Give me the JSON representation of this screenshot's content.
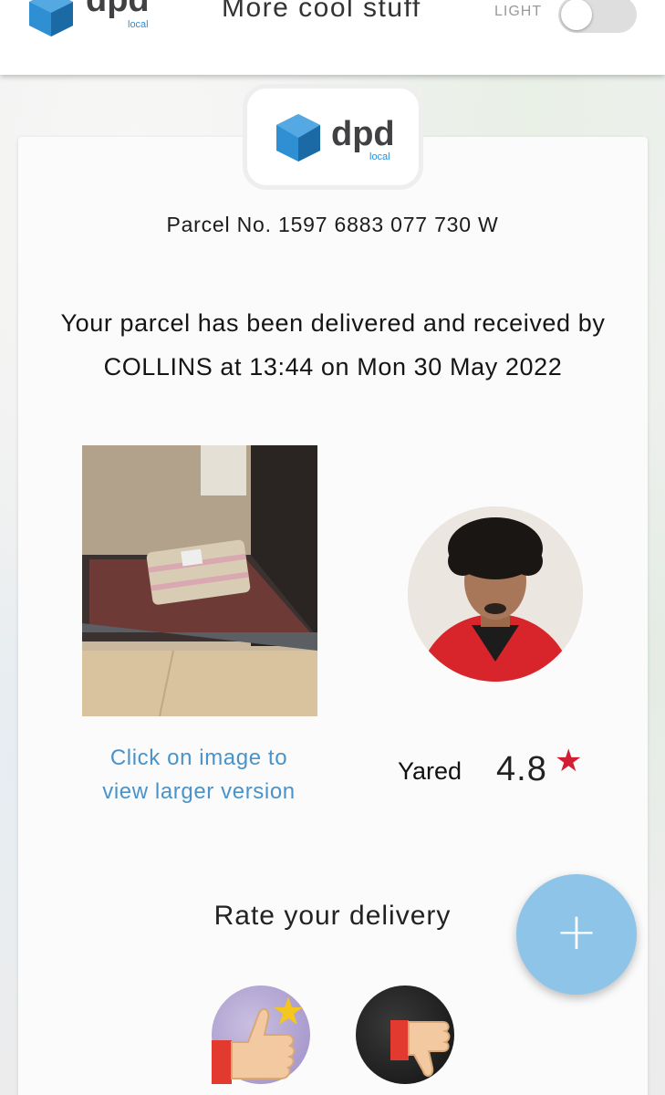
{
  "header": {
    "title": "More cool stuff",
    "theme_label": "LIGHT",
    "theme_on": false
  },
  "brand": {
    "name": "dpd",
    "sub": "local",
    "colors": {
      "cube": "#2f8fd3",
      "cube_dark": "#1b6aa6",
      "text": "#414042"
    }
  },
  "parcel": {
    "number_text": "Parcel No. 1597 6883 077 730 W",
    "status_line1": "Your parcel has been delivered and received by",
    "status_line2": "COLLINS at 13:44 on Mon 30 May 2022"
  },
  "photo": {
    "hint_line1": "Click on image to",
    "hint_line2": "view larger version"
  },
  "driver": {
    "name": "Yared",
    "rating": "4.8",
    "star_color": "#d11e34"
  },
  "rating": {
    "title": "Rate your delivery",
    "good_icon": "thumbs-up-icon",
    "bad_icon": "thumbs-down-icon"
  },
  "fab": {
    "icon": "plus-icon",
    "color": "#8ec4e8"
  }
}
